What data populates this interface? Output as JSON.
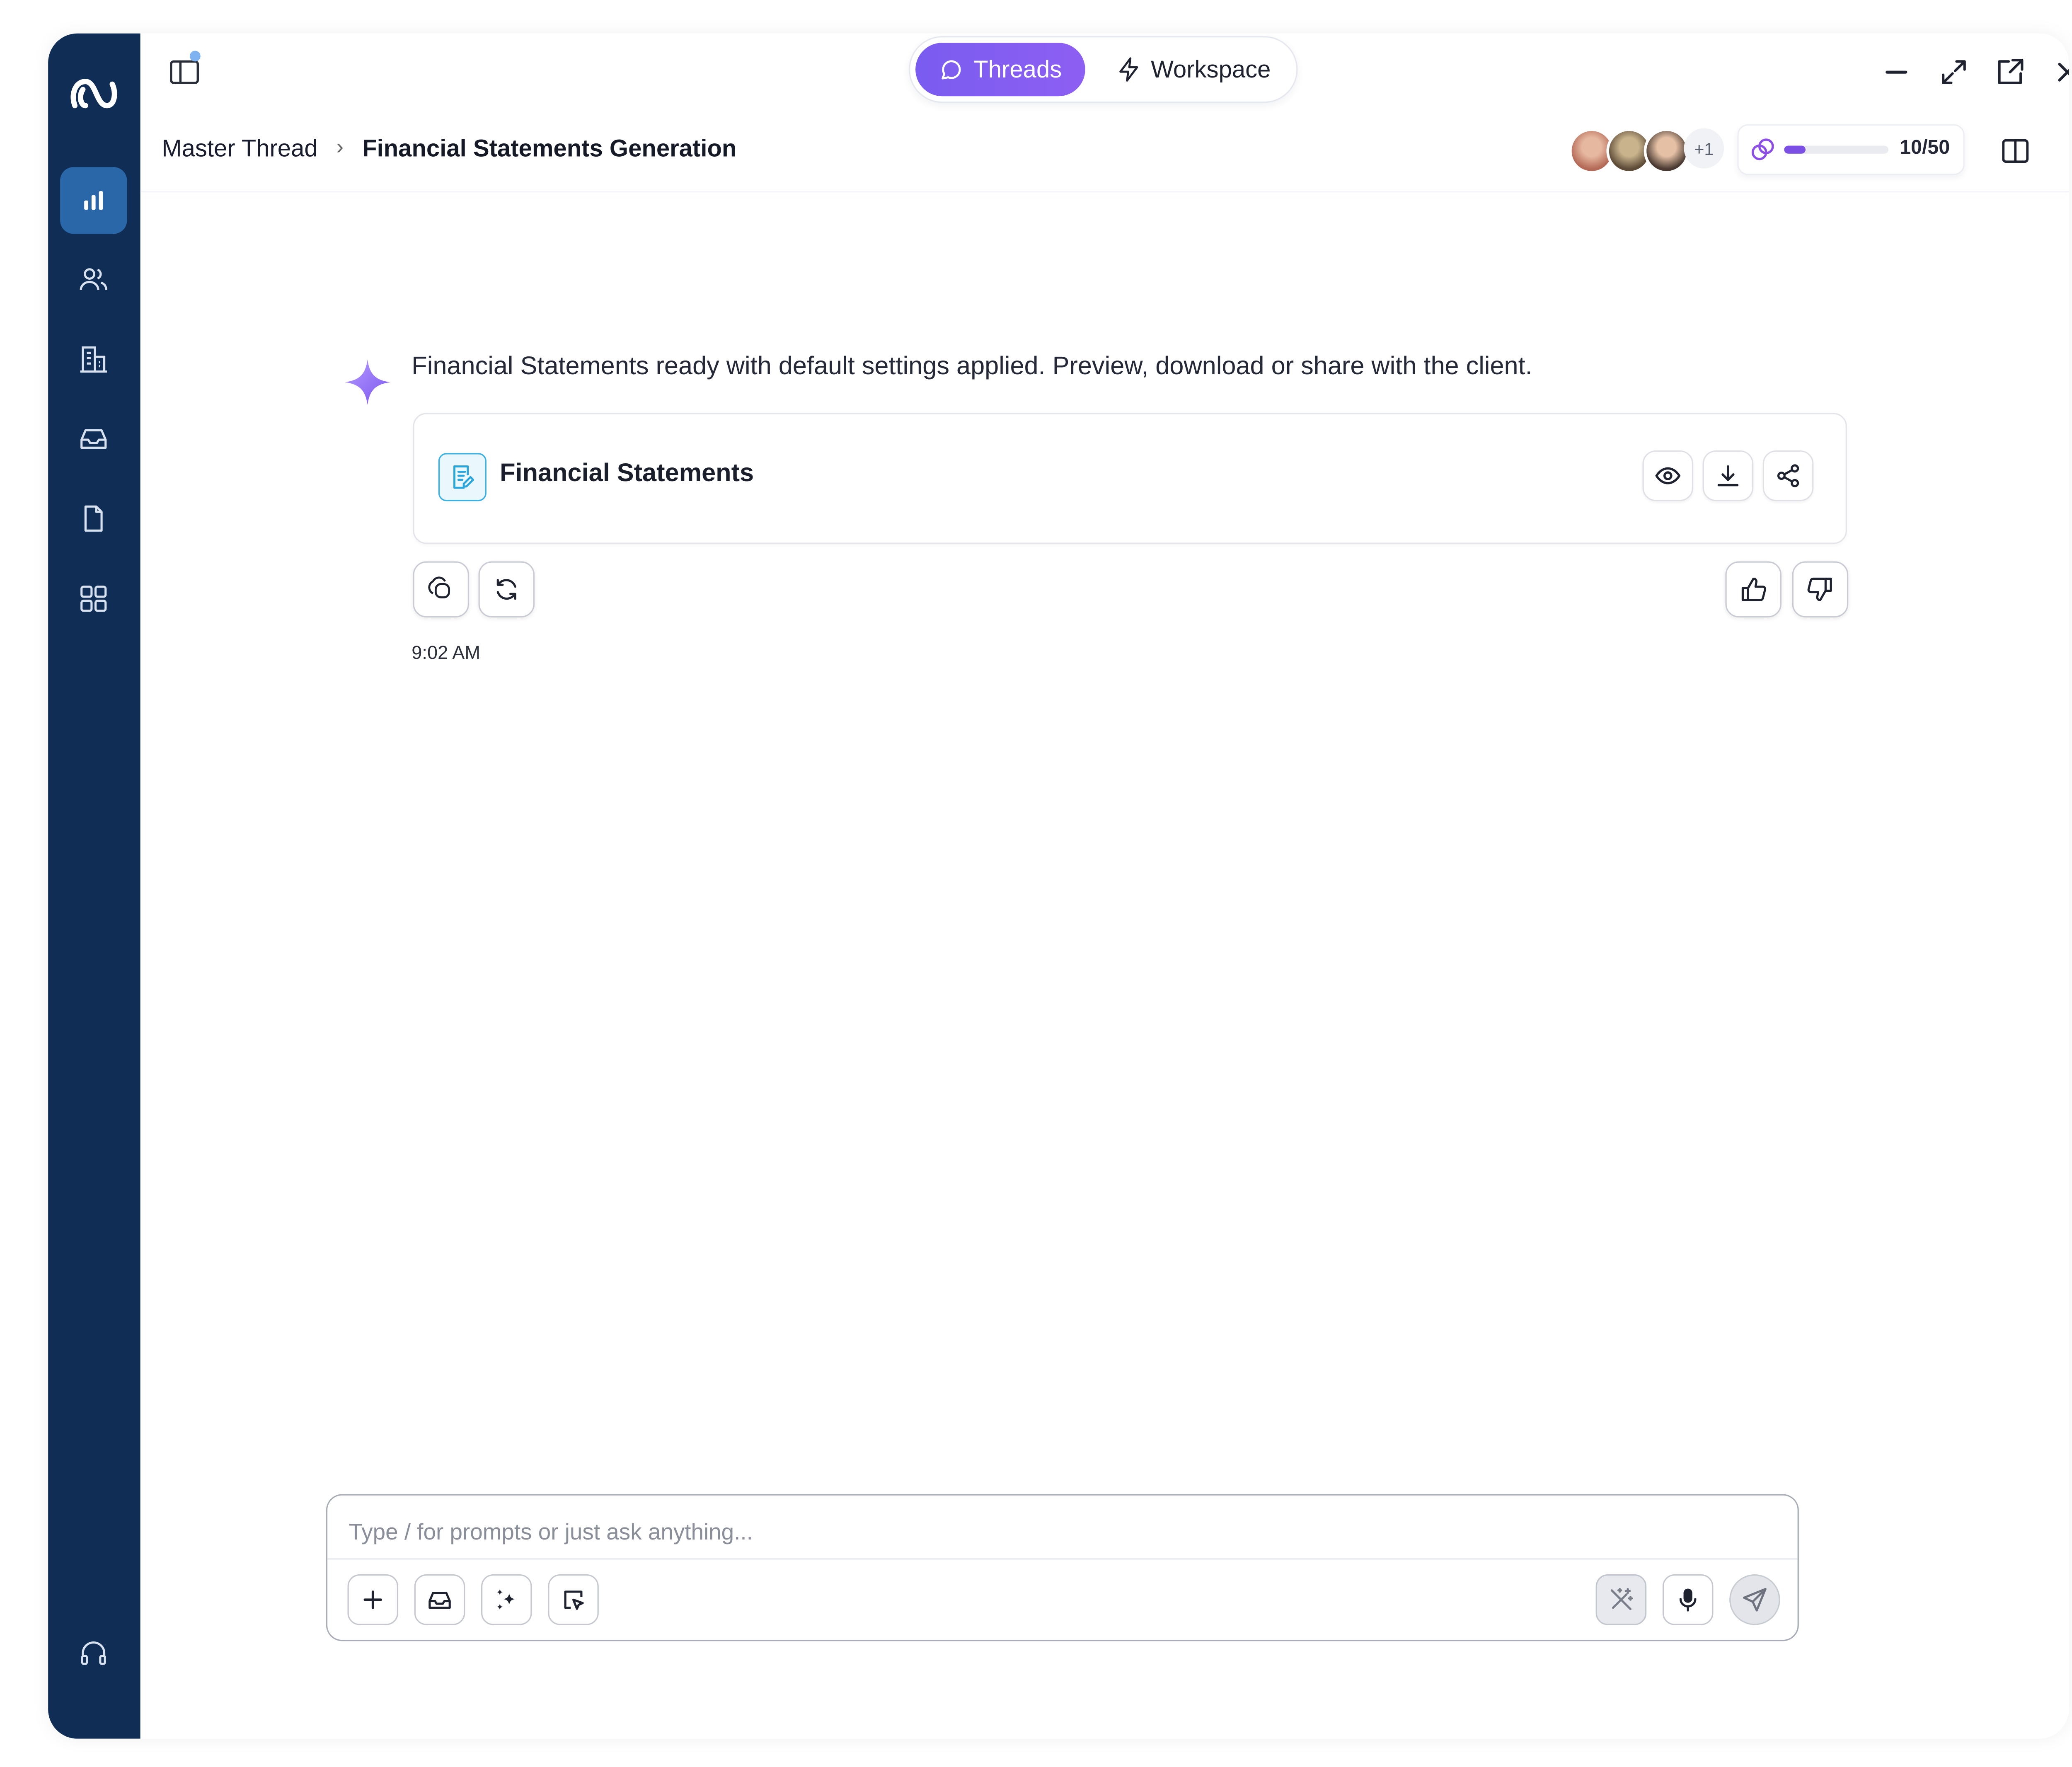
{
  "toggle": {
    "threads": "Threads",
    "workspace": "Workspace"
  },
  "breadcrumb": {
    "parent": "Master Thread",
    "separator": "›",
    "current": "Financial Statements Generation"
  },
  "collaborators": {
    "more": "+1"
  },
  "usage": {
    "text": "10/50",
    "used": 10,
    "total": 50
  },
  "message": {
    "text": "Financial Statements ready with default settings applied. Preview, download or share with the client.",
    "card_title": "Financial Statements",
    "timestamp": "9:02 AM"
  },
  "composer": {
    "placeholder": "Type / for prompts or just ask anything..."
  },
  "colors": {
    "sidebar": "#0f2d55",
    "sidebar_active": "#2a67a8",
    "accent": "#7a5cf0"
  },
  "icons": {
    "sidebar": [
      "analytics-icon",
      "users-icon",
      "building-icon",
      "inbox-icon",
      "document-icon",
      "apps-icon",
      "headset-icon"
    ],
    "card_actions": [
      "eye-icon",
      "download-icon",
      "share-icon"
    ],
    "message_actions": [
      "copy-icon",
      "refresh-icon",
      "thumbs-up-icon",
      "thumbs-down-icon"
    ],
    "composer": [
      "plus-icon",
      "inbox-icon",
      "sparkles-icon",
      "cursor-select-icon",
      "magic-wand-icon",
      "microphone-icon",
      "send-icon"
    ]
  }
}
